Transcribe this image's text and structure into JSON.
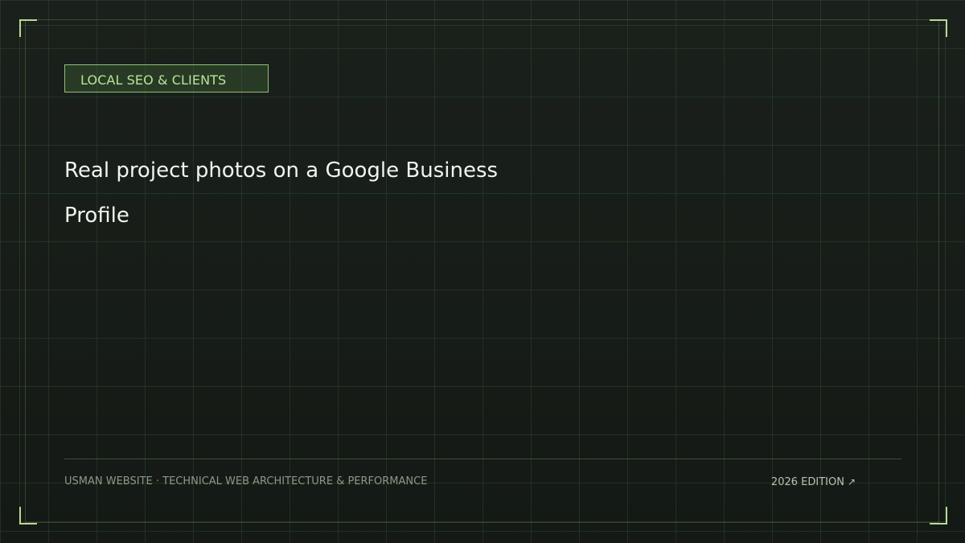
{
  "tag": {
    "label": "LOCAL SEO & CLIENTS"
  },
  "title": "Real project photos on a Google Business Profile",
  "footer": {
    "site": "USMAN WEBSITE · TECHNICAL WEB ARCHITECTURE & PERFORMANCE",
    "edition": "2026 EDITION",
    "edition_icon": "arrow-up-right-icon"
  },
  "colors": {
    "background": "#161b17",
    "grid": "#2c4a2c",
    "accent": "#b9e39a",
    "corner": "#b8d89a",
    "title": "#f1f4ee",
    "footer": "#8b9988"
  }
}
